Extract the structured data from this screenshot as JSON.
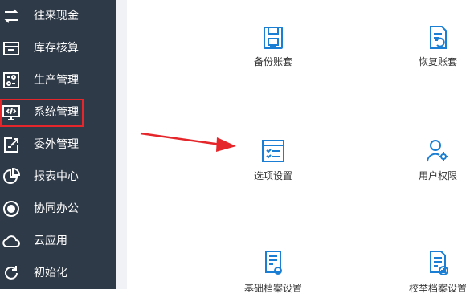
{
  "sidebar": {
    "items": [
      {
        "label": "往来现金",
        "icon": "exchange-icon"
      },
      {
        "label": "库存核算",
        "icon": "inventory-icon"
      },
      {
        "label": "生产管理",
        "icon": "production-icon"
      },
      {
        "label": "系统管理",
        "icon": "system-monitor-icon"
      },
      {
        "label": "委外管理",
        "icon": "outsource-icon"
      },
      {
        "label": "报表中心",
        "icon": "pie-chart-icon"
      },
      {
        "label": "协同办公",
        "icon": "target-icon"
      },
      {
        "label": "云应用",
        "icon": "cloud-icon"
      },
      {
        "label": "初始化",
        "icon": "refresh-icon"
      }
    ]
  },
  "tools": [
    {
      "label": "备份账套",
      "icon": "backup-icon"
    },
    {
      "label": "恢复账套",
      "icon": "restore-icon"
    },
    {
      "label": "选项设置",
      "icon": "options-icon"
    },
    {
      "label": "用户权限",
      "icon": "user-settings-icon"
    },
    {
      "label": "基础档案设置",
      "icon": "archive-settings-icon"
    },
    {
      "label": "校举档案设置",
      "icon": "document-add-icon"
    }
  ],
  "colors": {
    "sidebar_bg": "#2f3a48",
    "highlight": "#e5262b",
    "icon_blue": "#1a7fd4",
    "arrow": "#e5262b"
  }
}
